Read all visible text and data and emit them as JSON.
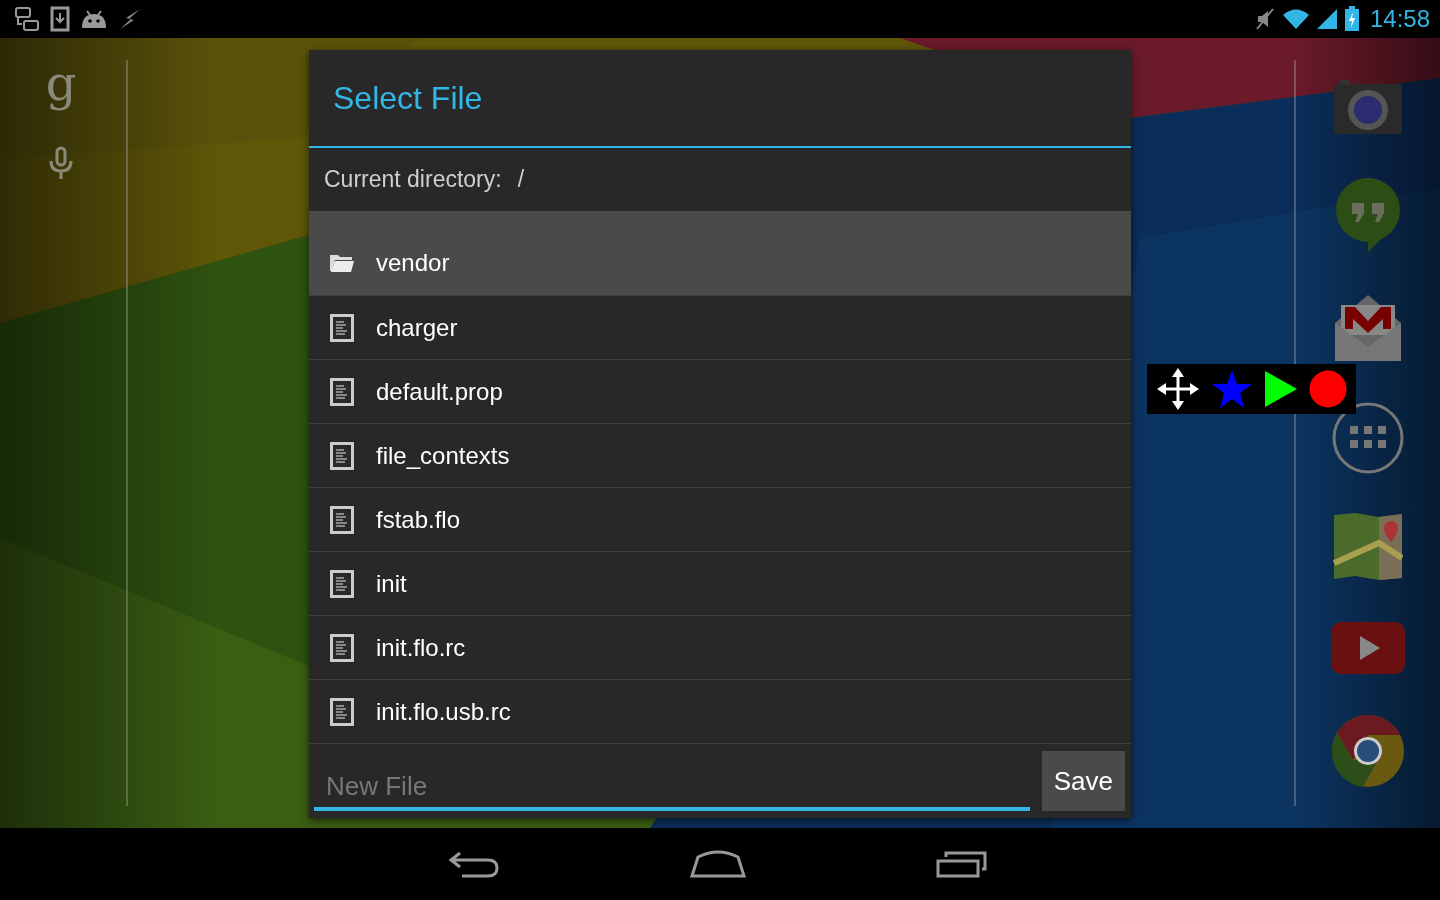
{
  "status_bar": {
    "time": "14:58"
  },
  "search_bar": {
    "logo": "g"
  },
  "dialog": {
    "title": "Select File",
    "current_directory_label": "Current directory:",
    "current_directory": "/",
    "items": [
      {
        "name": "vendor",
        "kind": "folder",
        "selected": true
      },
      {
        "name": "charger",
        "kind": "file",
        "selected": false
      },
      {
        "name": "default.prop",
        "kind": "file",
        "selected": false
      },
      {
        "name": "file_contexts",
        "kind": "file",
        "selected": false
      },
      {
        "name": "fstab.flo",
        "kind": "file",
        "selected": false
      },
      {
        "name": "init",
        "kind": "file",
        "selected": false
      },
      {
        "name": "init.flo.rc",
        "kind": "file",
        "selected": false
      },
      {
        "name": "init.flo.usb.rc",
        "kind": "file",
        "selected": false
      }
    ],
    "filename": {
      "placeholder": "New File"
    },
    "save_button": "Save"
  }
}
